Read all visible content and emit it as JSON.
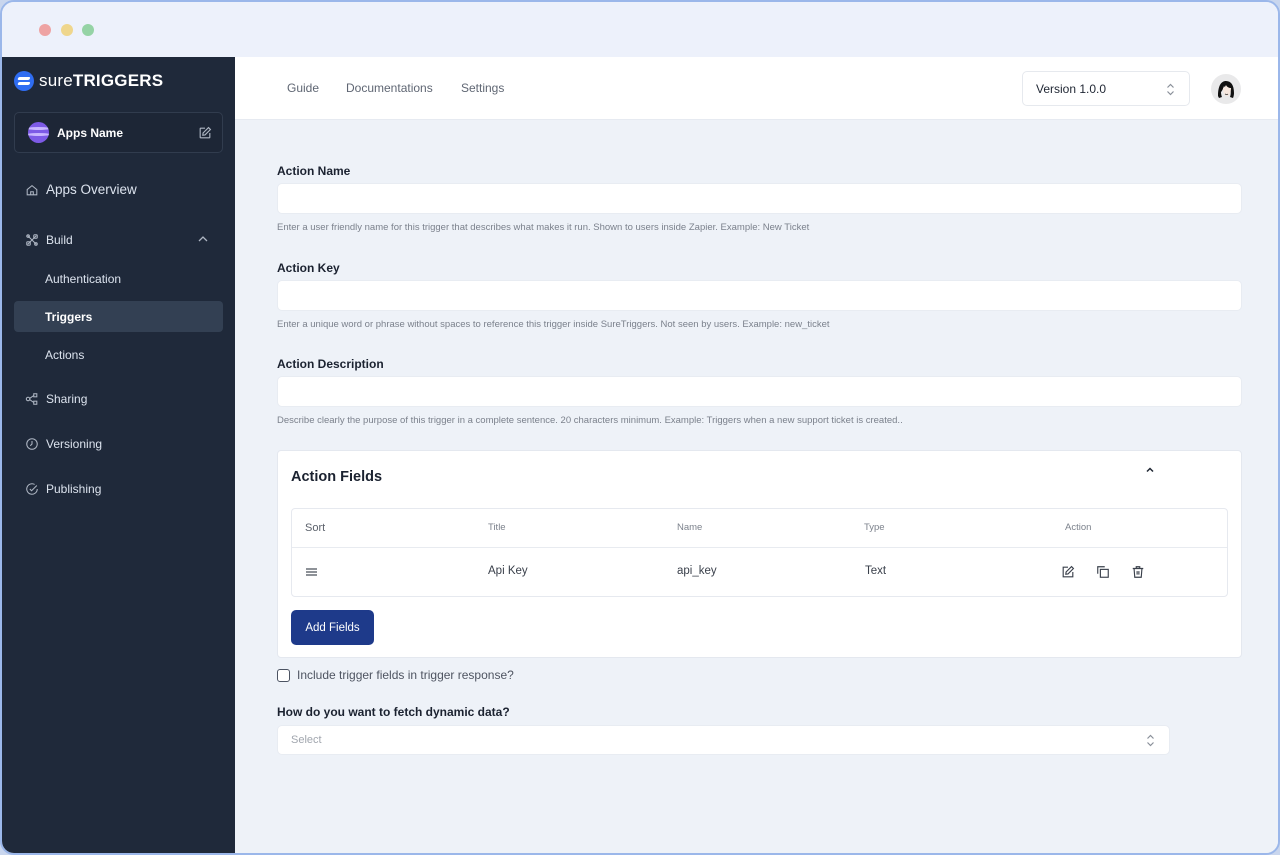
{
  "window": {
    "controls": [
      "close",
      "minimize",
      "maximize"
    ]
  },
  "brand": {
    "logo_light": "sure",
    "logo_bold": "TRIGGERS"
  },
  "app_card": {
    "name": "Apps Name"
  },
  "sidebar": {
    "items": [
      {
        "label": "Apps Overview",
        "icon": "home-icon"
      },
      {
        "label": "Build",
        "icon": "tools-icon",
        "expanded": true
      },
      {
        "label": "Authentication"
      },
      {
        "label": "Triggers",
        "active": true
      },
      {
        "label": "Actions"
      },
      {
        "label": "Sharing",
        "icon": "share-icon"
      },
      {
        "label": "Versioning",
        "icon": "clock-icon"
      },
      {
        "label": "Publishing",
        "icon": "check-circle-icon"
      }
    ]
  },
  "topbar": {
    "links": [
      "Guide",
      "Documentations",
      "Settings"
    ],
    "version": "Version 1.0.0"
  },
  "form": {
    "action_name": {
      "label": "Action Name",
      "value": "",
      "helper": "Enter a user friendly name for this trigger that describes what makes it run. Shown to users inside Zapier. Example: New Ticket"
    },
    "action_key": {
      "label": "Action Key",
      "value": "",
      "helper": "Enter a unique word or phrase without spaces to reference this trigger inside SureTriggers. Not seen by users. Example: new_ticket"
    },
    "action_description": {
      "label": "Action Description",
      "value": "",
      "helper": "Describe clearly the purpose of this trigger in a complete sentence. 20 characters minimum. Example: Triggers when a new support ticket is created.."
    }
  },
  "action_fields": {
    "title": "Action Fields",
    "columns": [
      "Sort",
      "Title",
      "Name",
      "Type",
      "Action"
    ],
    "rows": [
      {
        "title": "Api Key",
        "name": "api_key",
        "type": "Text"
      }
    ],
    "add_button": "Add Fields"
  },
  "include_trigger": {
    "label": "Include trigger fields in trigger response?",
    "checked": false
  },
  "dynamic_data": {
    "label": "How do you want to fetch dynamic data?",
    "placeholder": "Select"
  },
  "colors": {
    "sidebar_bg": "#1f293a",
    "primary_button": "#1e3a8a",
    "brand_blue": "#2f6df2",
    "app_avatar": "#7d5ae6"
  }
}
